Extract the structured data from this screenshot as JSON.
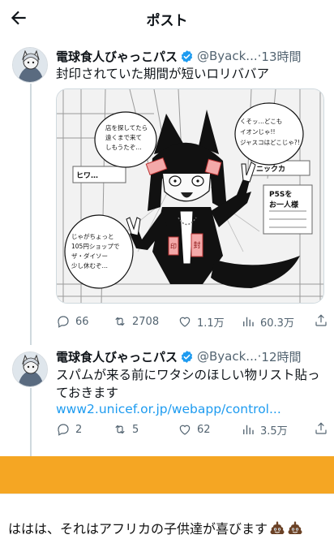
{
  "header": {
    "title": "ポスト"
  },
  "tweets": [
    {
      "name": "電球食人びゃっこパス",
      "handle": "@Byack...",
      "separator": " · ",
      "time": "13時間",
      "text": "封印されていた期間が短いロリババア",
      "media": {
        "bubbles": {
          "top_left": [
            "店を探してたら",
            "遠くまで来て",
            "しもうたぞ…"
          ],
          "top_right": [
            "くそッ…どこも",
            "イオンじゃ!!",
            "ジャスコはどこじゃ?!"
          ],
          "bottom_left": [
            "じゃがちょっと",
            "105円ショップで",
            "ザ・ダイソー",
            "少し休むぞ…"
          ]
        },
        "signs": [
          "ヒワ…",
          "ニックカ",
          "P5Sを",
          "お一人様"
        ],
        "tags": [
          "封",
          "印"
        ]
      },
      "actions": {
        "replies": "66",
        "reposts": "2708",
        "likes": "1.1万",
        "views": "60.3万"
      }
    },
    {
      "name": "電球食人びゃっこパス",
      "handle": "@Byack...",
      "separator": " · ",
      "time": "12時間",
      "text_lines": [
        "スパムが来る前にワタシのほしい物リスト貼っ",
        "ておきます"
      ],
      "link": "www2.unicef.or.jp/webapp/control...",
      "actions": {
        "replies": "2",
        "reposts": "5",
        "likes": "62",
        "views": "3.5万"
      }
    }
  ],
  "comment": {
    "text": "ははは、それはアフリカの子供達が喜びます"
  },
  "colors": {
    "accent": "#1d9bf0",
    "muted": "#536471",
    "highlight": "#f5a623",
    "verified": "#1d9bf0"
  },
  "icons": [
    "back-arrow-icon",
    "verified-badge-icon",
    "reply-icon",
    "repost-icon",
    "like-icon",
    "views-icon",
    "share-icon"
  ]
}
